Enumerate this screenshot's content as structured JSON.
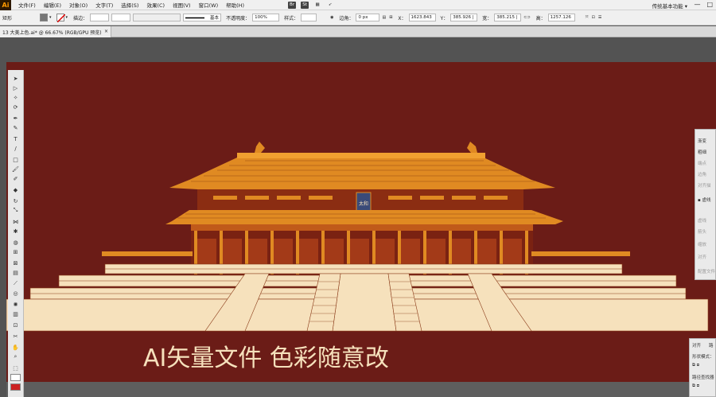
{
  "menubar": {
    "logo": "Ai",
    "items": [
      "文件(F)",
      "编辑(E)",
      "对象(O)",
      "文字(T)",
      "选择(S)",
      "效果(C)",
      "视图(V)",
      "窗口(W)",
      "帮助(H)"
    ],
    "app_icons": [
      "Br",
      "St"
    ],
    "workspace": "传统基本功能 ▾",
    "window_controls": [
      "—",
      "□"
    ]
  },
  "control_bar": {
    "type_label": "矩形",
    "stroke_label": "描边：",
    "stroke_style": "基本",
    "opacity_label": "不透明度：",
    "opacity_value": "100%",
    "style_label": "样式：",
    "corner_label": "边角：",
    "corner_value": "0 px",
    "x_label": "X：",
    "x_value": "1623.843",
    "y_label": "Y：",
    "y_value": "385.926 |",
    "w_label": "宽：",
    "w_value": "385.215 |",
    "h_label": "高：",
    "h_value": "1257.126"
  },
  "tab": {
    "label": "13 大美上色.ai* @ 66.67% (RGB/GPU 预览)",
    "close": "×"
  },
  "panels": {
    "gradient_title": "渐变",
    "gradient_rows": [
      "粗细",
      "端点",
      "边角",
      "对齐描",
      "▪ 虚线",
      "虚线",
      "",
      "箭头",
      "缩放",
      "对齐",
      "配置文件"
    ],
    "align_tabs": [
      "对齐",
      "路"
    ],
    "align_rows": [
      "形状模式：",
      "",
      "路径查找器"
    ]
  },
  "canvas": {
    "headline": "AI矢量文件 色彩随意改",
    "plaque_text": "太和",
    "bg_color": "#6b1c17",
    "roof_color": "#e08a22",
    "cream_color": "#f6e1bc"
  }
}
